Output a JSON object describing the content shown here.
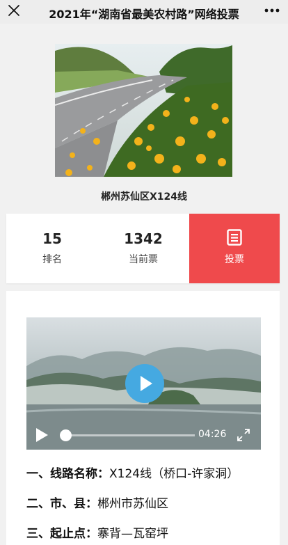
{
  "header": {
    "title": "2021年“湖南省最美农村路”网络投票",
    "close_icon": "close-icon",
    "more_icon": "more-dots-icon"
  },
  "entry": {
    "caption": "郴州苏仙区X124线"
  },
  "stats": {
    "rank_value": "15",
    "rank_label": "排名",
    "votes_value": "1342",
    "votes_label": "当前票",
    "vote_button_label": "投票"
  },
  "video": {
    "duration": "04:26",
    "progress": 0.0
  },
  "details": [
    {
      "label": "一、线路名称：",
      "value": "X124线（桥口-许家洞）"
    },
    {
      "label": "二、市、县：",
      "value": "郴州市苏仙区"
    },
    {
      "label": "三、起止点：",
      "value": "寨背—瓦窑坪"
    }
  ],
  "colors": {
    "accent_red": "#ef4a4c",
    "play_blue": "#45a9e1",
    "topbar_bg": "#ededed"
  }
}
